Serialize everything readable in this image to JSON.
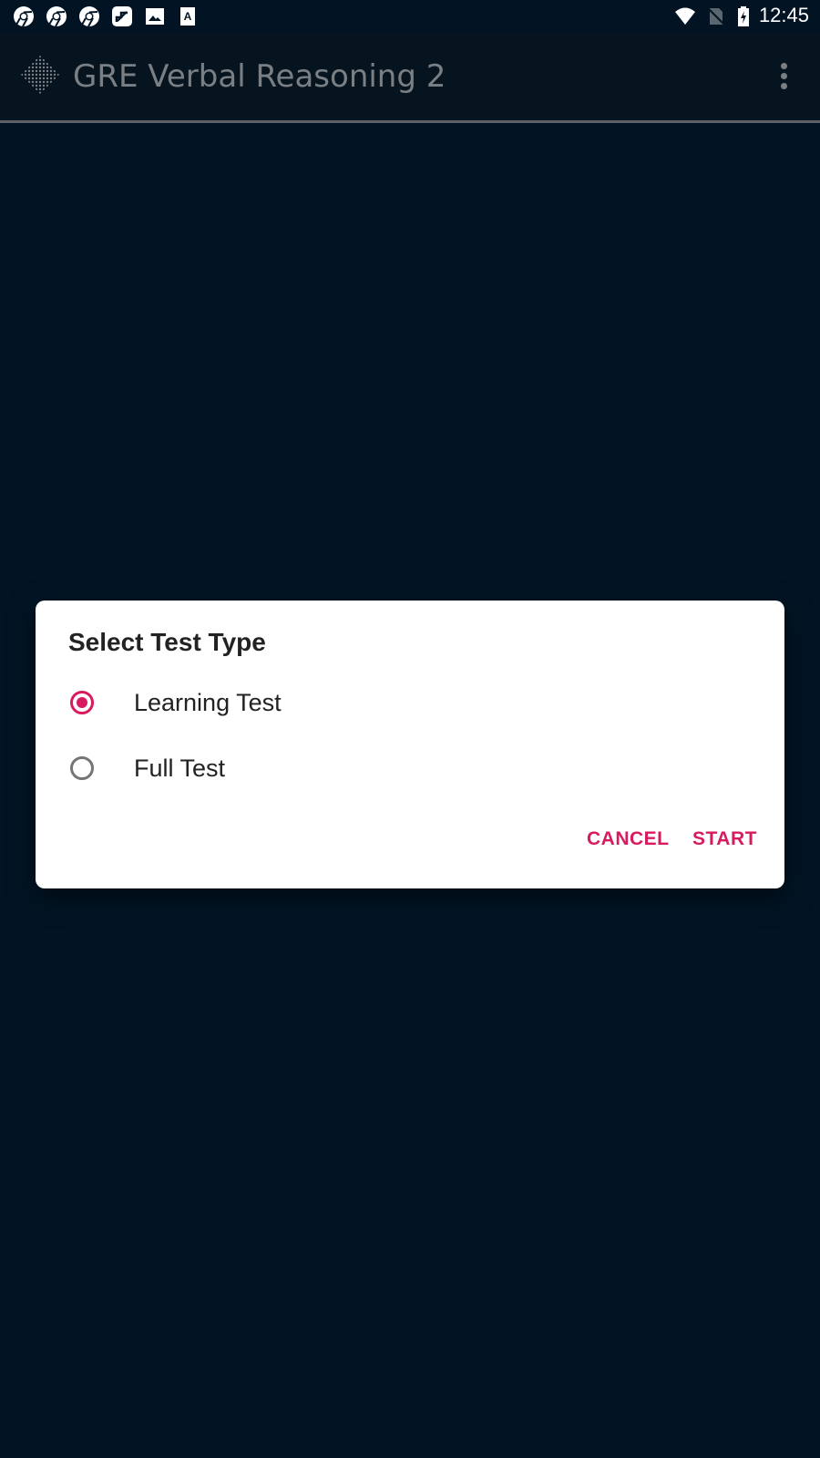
{
  "status_bar": {
    "notification_icons": [
      "chrome-icon",
      "chrome-icon",
      "chrome-icon",
      "stairs-app-icon",
      "image-icon",
      "font-app-icon"
    ],
    "system_icons": [
      "wifi-icon",
      "no-sim-icon",
      "battery-charging-icon"
    ],
    "time": "12:45"
  },
  "app_bar": {
    "title": "GRE Verbal Reasoning 2",
    "logo_icon": "diamond-grid-logo-icon",
    "menu_icon": "more-vert-icon"
  },
  "dialog": {
    "title": "Select Test Type",
    "options": [
      {
        "label": "Learning Test",
        "selected": true
      },
      {
        "label": "Full Test",
        "selected": false
      }
    ],
    "cancel_label": "CANCEL",
    "start_label": "START"
  },
  "colors": {
    "accent": "#d81b60",
    "background": "#021424",
    "app_bar": "#06141f"
  }
}
